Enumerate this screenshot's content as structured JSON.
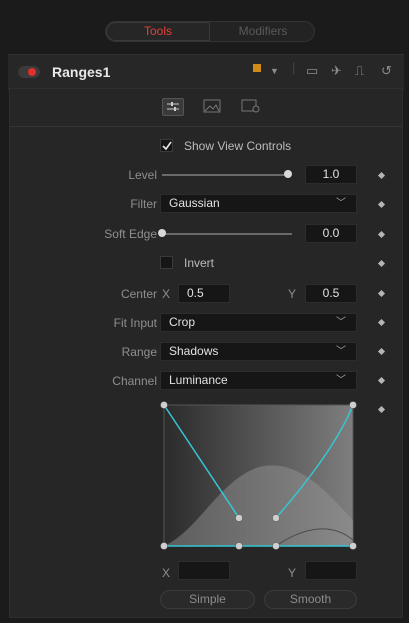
{
  "tabs": {
    "tools": "Tools",
    "modifiers": "Modifiers"
  },
  "node": {
    "name": "Ranges1",
    "color": "#d08a17"
  },
  "controls": {
    "show_view_controls": "Show View Controls",
    "level": {
      "label": "Level",
      "value": "1.0",
      "fraction": 1.0
    },
    "filter": {
      "label": "Filter",
      "value": "Gaussian"
    },
    "soft_edge": {
      "label": "Soft Edge",
      "value": "0.0",
      "fraction": 0.0
    },
    "invert": "Invert",
    "center": {
      "label": "Center",
      "x_label": "X",
      "x": "0.5",
      "y_label": "Y",
      "y": "0.5"
    },
    "fit_input": {
      "label": "Fit Input",
      "value": "Crop"
    },
    "range": {
      "label": "Range",
      "value": "Shadows"
    },
    "channel": {
      "label": "Channel",
      "value": "Luminance"
    }
  },
  "curve": {
    "x_label": "X",
    "x_value": "",
    "y_label": "Y",
    "y_value": "",
    "simple": "Simple",
    "smooth": "Smooth"
  },
  "colors": {
    "accent_red": "#e0312b",
    "curve_cyan": "#36c6d6"
  }
}
